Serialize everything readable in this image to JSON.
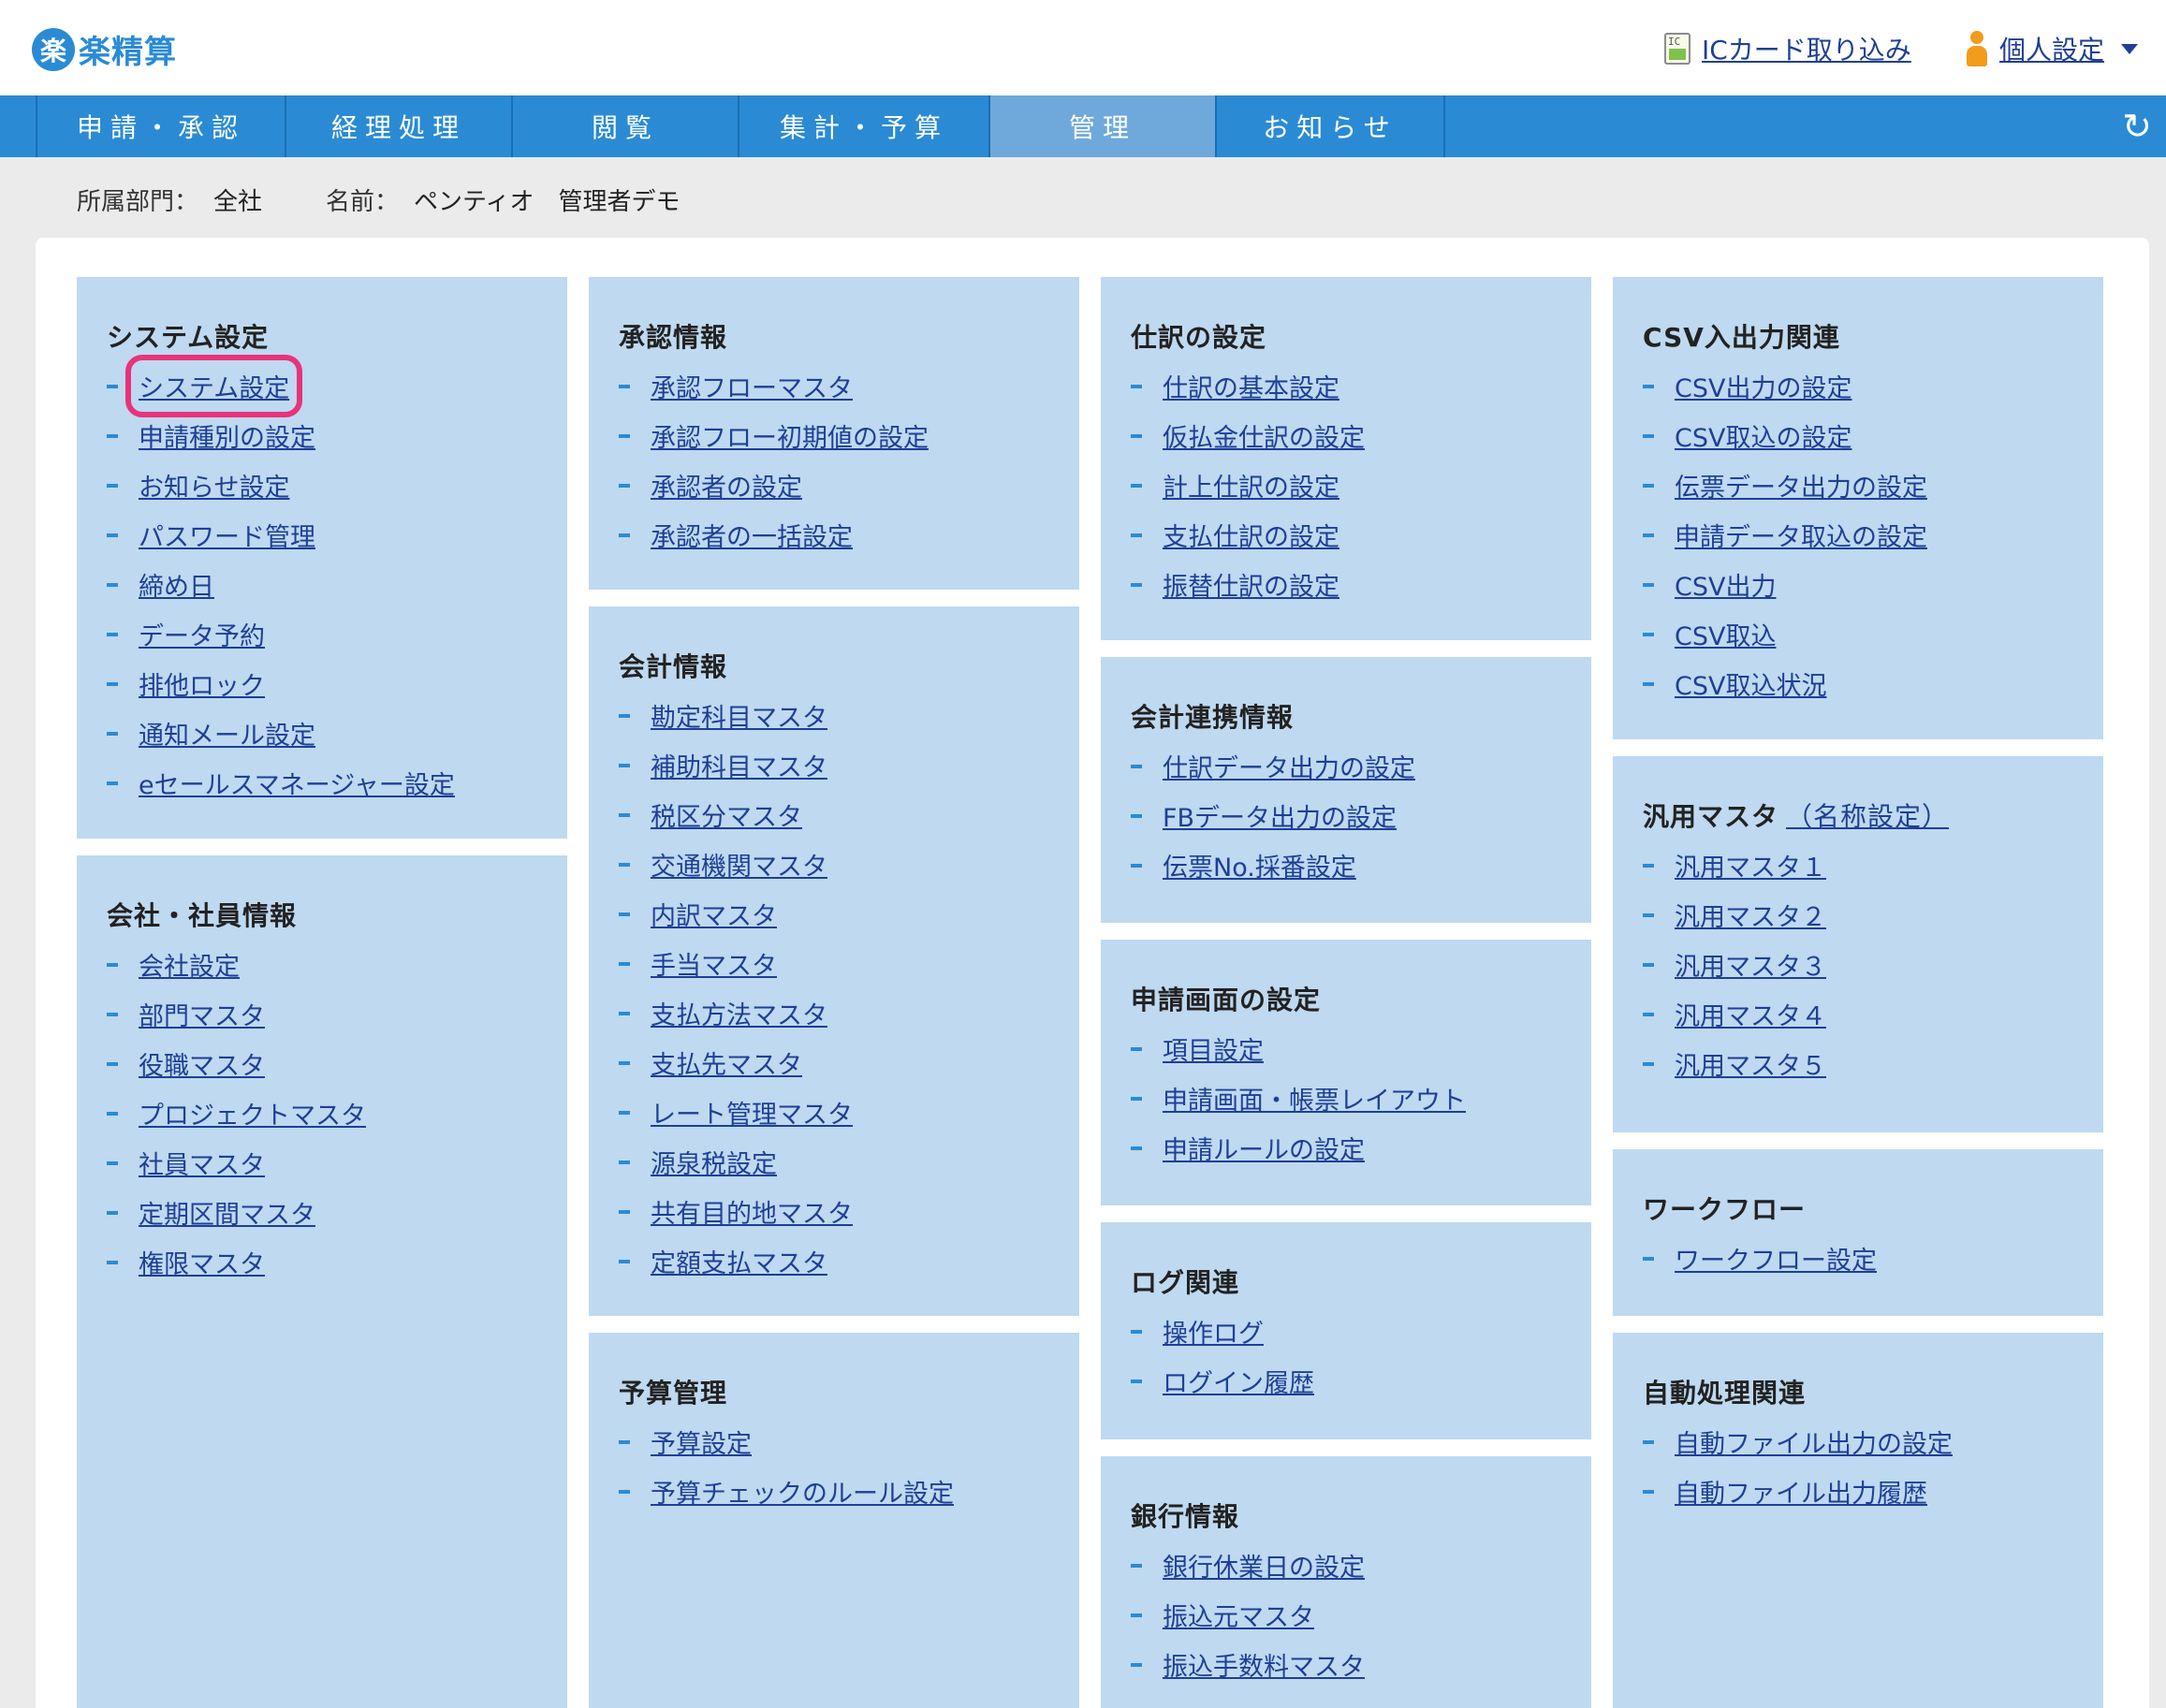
{
  "header": {
    "logo_mark": "楽",
    "logo_text": "楽精算",
    "ic_icon_text": "IC",
    "ic_card_link": "ICカード取り込み",
    "personal_settings": "個人設定"
  },
  "nav": {
    "tabs": [
      {
        "label": "申請・承認"
      },
      {
        "label": "経理処理"
      },
      {
        "label": "閲覧"
      },
      {
        "label": "集計・予算"
      },
      {
        "label": "管理"
      },
      {
        "label": "お知らせ"
      }
    ],
    "active_tab": "管理",
    "reload_icon": "↻"
  },
  "user_info": {
    "dept_label": "所属部門：",
    "dept_value": "全社",
    "name_label": "名前：",
    "name_value": "ペンティオ　管理者デモ"
  },
  "sections": {
    "system": {
      "title": "システム設定",
      "items": [
        "システム設定",
        "申請種別の設定",
        "お知らせ設定",
        "パスワード管理",
        "締め日",
        "データ予約",
        "排他ロック",
        "通知メール設定",
        "eセールスマネージャー設定"
      ],
      "highlighted": "システム設定"
    },
    "company": {
      "title": "会社・社員情報",
      "items": [
        "会社設定",
        "部門マスタ",
        "役職マスタ",
        "プロジェクトマスタ",
        "社員マスタ",
        "定期区間マスタ",
        "権限マスタ"
      ]
    },
    "approval": {
      "title": "承認情報",
      "items": [
        "承認フローマスタ",
        "承認フロー初期値の設定",
        "承認者の設定",
        "承認者の一括設定"
      ]
    },
    "accounting": {
      "title": "会計情報",
      "items": [
        "勘定科目マスタ",
        "補助科目マスタ",
        "税区分マスタ",
        "交通機関マスタ",
        "内訳マスタ",
        "手当マスタ",
        "支払方法マスタ",
        "支払先マスタ",
        "レート管理マスタ",
        "源泉税設定",
        "共有目的地マスタ",
        "定額支払マスタ"
      ]
    },
    "budget": {
      "title": "予算管理",
      "items": [
        "予算設定",
        "予算チェックのルール設定"
      ]
    },
    "journal": {
      "title": "仕訳の設定",
      "items": [
        "仕訳の基本設定",
        "仮払金仕訳の設定",
        "計上仕訳の設定",
        "支払仕訳の設定",
        "振替仕訳の設定"
      ]
    },
    "acct_link": {
      "title": "会計連携情報",
      "items": [
        "仕訳データ出力の設定",
        "FBデータ出力の設定",
        "伝票No.採番設定"
      ]
    },
    "app_screen": {
      "title": "申請画面の設定",
      "items": [
        "項目設定",
        "申請画面・帳票レイアウト",
        "申請ルールの設定"
      ]
    },
    "log": {
      "title": "ログ関連",
      "items": [
        "操作ログ",
        "ログイン履歴"
      ]
    },
    "bank": {
      "title": "銀行情報",
      "items": [
        "銀行休業日の設定",
        "振込元マスタ",
        "振込手数料マスタ"
      ]
    },
    "csv": {
      "title": "CSV入出力関連",
      "items": [
        "CSV出力の設定",
        "CSV取込の設定",
        "伝票データ出力の設定",
        "申請データ取込の設定",
        "CSV出力",
        "CSV取込",
        "CSV取込状況"
      ]
    },
    "general_master": {
      "title": "汎用マスタ",
      "title_link": "（名称設定）",
      "items": [
        "汎用マスタ１",
        "汎用マスタ２",
        "汎用マスタ３",
        "汎用マスタ４",
        "汎用マスタ５"
      ]
    },
    "workflow": {
      "title": "ワークフロー",
      "items": [
        "ワークフロー設定"
      ]
    },
    "auto": {
      "title": "自動処理関連",
      "items": [
        "自動ファイル出力の設定",
        "自動ファイル出力履歴"
      ]
    }
  }
}
